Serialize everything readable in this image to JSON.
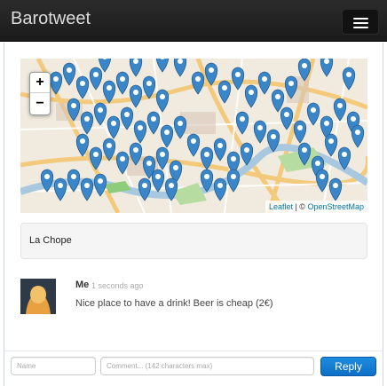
{
  "navbar": {
    "brand": "Barotweet"
  },
  "map": {
    "zoom_in": "+",
    "zoom_out": "−",
    "attribution_leaflet": "Leaflet",
    "attribution_sep": " | © ",
    "attribution_osm": "OpenStreetMap",
    "marker_color": "#3a86c8"
  },
  "place": {
    "name": "La Chope"
  },
  "comments": [
    {
      "author": "Me",
      "time": "1 seconds ago",
      "text": "Nice place to have a drink! Beer is cheap (2€)"
    }
  ],
  "form": {
    "name_placeholder": "Name",
    "comment_placeholder": "Comment... (142 characters max)",
    "reply_label": "Reply"
  },
  "colors": {
    "navbar": "#222222",
    "accent": "#0f6fc6"
  }
}
